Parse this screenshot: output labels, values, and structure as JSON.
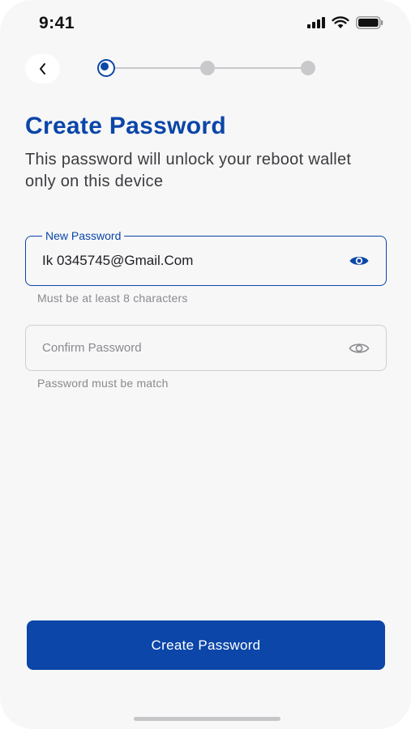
{
  "status_bar": {
    "time": "9:41",
    "icons": [
      "cellular-signal-icon",
      "wifi-icon",
      "battery-icon"
    ]
  },
  "header": {
    "back_icon": "chevron-left-icon",
    "stepper": {
      "total_steps": 3,
      "current_step": 1
    }
  },
  "content": {
    "title": "Create Password",
    "subtitle": "This password will unlock your reboot wallet only on this device"
  },
  "new_password": {
    "label": "New Password",
    "value": "Ik 0345745@Gmail.Com",
    "helper": "Must be at least 8 characters",
    "eye_icon": "eye-filled-icon"
  },
  "confirm_password": {
    "placeholder": "Confirm Password",
    "value": "",
    "helper": "Password must be match",
    "eye_icon": "eye-outline-icon"
  },
  "actions": {
    "primary_label": "Create Password"
  },
  "colors": {
    "accent": "#0b46a8",
    "background": "#f7f7f8",
    "muted_text": "#8a8a8f",
    "inactive_step": "#c9c9cc"
  }
}
